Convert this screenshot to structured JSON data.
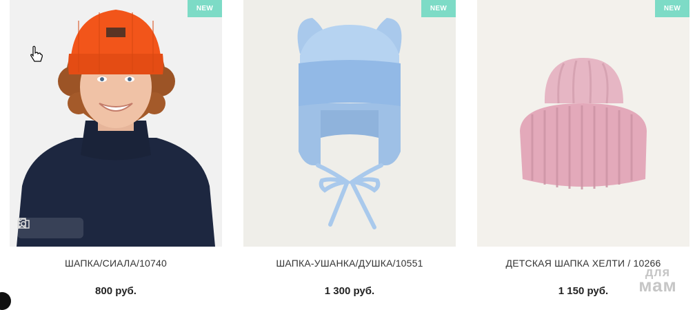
{
  "theme": {
    "badge_color": "#7ddbc6"
  },
  "products": [
    {
      "badge": "NEW",
      "name": "ШАПКА/СИАЛА/10740",
      "price": "800 руб."
    },
    {
      "badge": "NEW",
      "name": "ШАПКА-УШАНКА/ДУШКА/10551",
      "price": "1 300 руб."
    },
    {
      "badge": "NEW",
      "name": "ДЕТСКАЯ ШАПКА ХЕЛТИ / 10266",
      "price": "1 150 руб."
    }
  ],
  "image_toolbar": {
    "icons": [
      "bookmark-icon",
      "camera-icon",
      "more-vertical-icon"
    ]
  },
  "watermark": {
    "line1": "для",
    "line2": "мам"
  }
}
